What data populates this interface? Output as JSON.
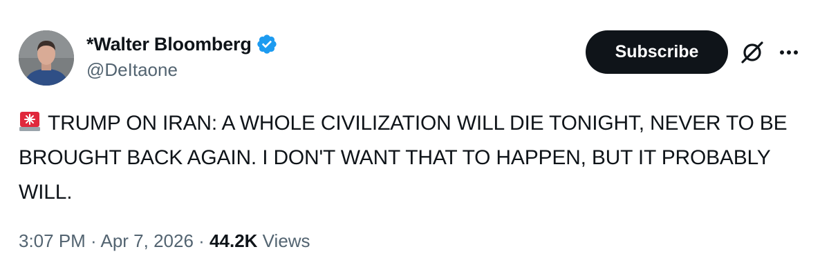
{
  "author": {
    "display_name": "*Walter Bloomberg",
    "handle": "@DeItaone",
    "verified": true,
    "avatar_icon": "user-avatar-photo"
  },
  "actions": {
    "subscribe_label": "Subscribe",
    "grok_icon": "grok-icon",
    "more_icon": "more-options-icon"
  },
  "tweet": {
    "alert_icon": "rotating-light-emoji",
    "text": "TRUMP ON IRAN: A WHOLE CIVILIZATION WILL DIE TONIGHT, NEVER TO BE BROUGHT BACK AGAIN. I DON'T WANT THAT TO HAPPEN, BUT IT PROBABLY WILL."
  },
  "meta": {
    "time": "3:07 PM",
    "separator": " · ",
    "date": "Apr 7, 2026",
    "views_count": "44.2K",
    "views_label": "Views"
  },
  "colors": {
    "text_primary": "#0f1419",
    "text_secondary": "#536471",
    "verified_blue": "#1d9bf0",
    "button_bg": "#0f1419",
    "button_text": "#ffffff",
    "siren_red": "#e0283c"
  }
}
